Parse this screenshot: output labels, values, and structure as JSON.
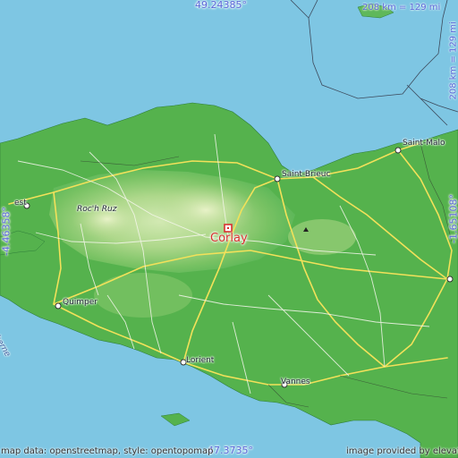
{
  "map": {
    "place_name": "Corlay",
    "coordinates": {
      "north": "49.24385°",
      "south": "47.3735°",
      "west": "-4.46358°",
      "east": "-1.65108°"
    },
    "scale": {
      "horizontal": "208 km = 129 mi",
      "vertical": "208 km = 129 mi"
    },
    "cities": [
      {
        "name": "Saint-Malo"
      },
      {
        "name": "Saint-Brieuc"
      },
      {
        "name": "Quimper"
      },
      {
        "name": "Lorient"
      },
      {
        "name": "Vannes"
      },
      {
        "name": "Roc'h Ruz"
      }
    ],
    "partial_labels": {
      "brest_fragment": "est",
      "left_edge_fragment": "herne"
    },
    "attribution": "map data: openstreetmap, style: opentopomap",
    "credit": "image provided by elevation.city",
    "colors": {
      "sea": "#7ec6e3",
      "lowland": "#4caf50",
      "upland": "#c5e4a0",
      "highlight": "#d93030",
      "coord_text": "#5a67d8"
    }
  }
}
